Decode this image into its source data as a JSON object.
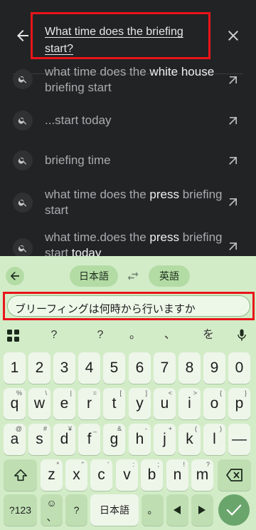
{
  "search": {
    "query": "What time does the briefing start?"
  },
  "suggestions": [
    {
      "parts": [
        {
          "t": "what time does the ",
          "em": false
        },
        {
          "t": "white house",
          "em": true
        },
        {
          "t": " briefing start",
          "em": false
        }
      ]
    },
    {
      "parts": [
        {
          "t": "...start today",
          "em": false
        }
      ]
    },
    {
      "parts": [
        {
          "t": "briefing time",
          "em": false
        }
      ]
    },
    {
      "parts": [
        {
          "t": "what time does the ",
          "em": false
        },
        {
          "t": "press",
          "em": true
        },
        {
          "t": " briefing start",
          "em": false
        }
      ]
    },
    {
      "parts": [
        {
          "t": "what time.does the ",
          "em": false
        },
        {
          "t": "press",
          "em": true
        },
        {
          "t": " briefing start ",
          "em": false
        },
        {
          "t": "today",
          "em": true
        }
      ]
    }
  ],
  "keyboard": {
    "source_lang": "日本語",
    "target_lang": "英語",
    "translate_input": "ブリーフィングは何時から行いますか",
    "symbols": [
      "?",
      "?",
      "。",
      "、",
      "を"
    ],
    "numbers": [
      "1",
      "2",
      "3",
      "4",
      "5",
      "6",
      "7",
      "8",
      "9",
      "0"
    ],
    "row1": [
      {
        "k": "q",
        "h": "%"
      },
      {
        "k": "w",
        "h": "\\"
      },
      {
        "k": "e",
        "h": "|"
      },
      {
        "k": "r",
        "h": "="
      },
      {
        "k": "t",
        "h": "["
      },
      {
        "k": "y",
        "h": "]"
      },
      {
        "k": "u",
        "h": "<"
      },
      {
        "k": "i",
        "h": ">"
      },
      {
        "k": "o",
        "h": "{"
      },
      {
        "k": "p",
        "h": "}"
      }
    ],
    "row2": [
      {
        "k": "a",
        "h": "@"
      },
      {
        "k": "s",
        "h": "#"
      },
      {
        "k": "d",
        "h": "¥"
      },
      {
        "k": "f",
        "h": "_"
      },
      {
        "k": "g",
        "h": "&"
      },
      {
        "k": "h",
        "h": "-"
      },
      {
        "k": "j",
        "h": "+"
      },
      {
        "k": "k",
        "h": "("
      },
      {
        "k": "l",
        "h": ")"
      },
      {
        "k": "—",
        "h": ""
      }
    ],
    "row3": [
      {
        "k": "z",
        "h": "*"
      },
      {
        "k": "x",
        "h": "\""
      },
      {
        "k": "c",
        "h": "'"
      },
      {
        "k": "v",
        "h": ":"
      },
      {
        "k": "b",
        "h": ";"
      },
      {
        "k": "n",
        "h": "!"
      },
      {
        "k": "m",
        "h": "?"
      }
    ],
    "mode_key": "?123",
    "emoji_key_top": "☺",
    "emoji_key_bottom": "、",
    "question_key": "?",
    "space_label": "日本語",
    "period_key": "。"
  }
}
